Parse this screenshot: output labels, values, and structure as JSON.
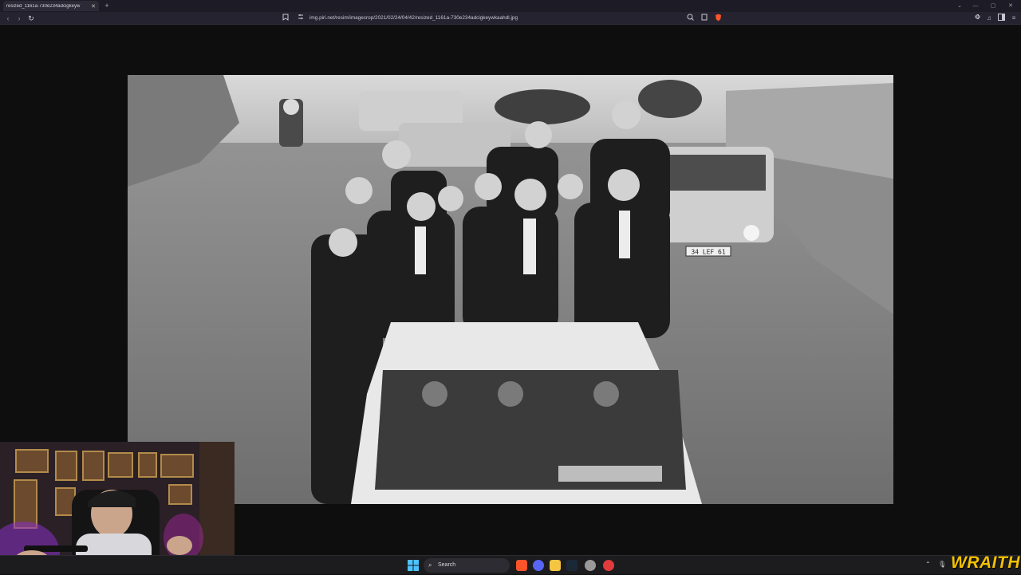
{
  "browser": {
    "tab_title": "resized_1161a-730e234adcigkeyw",
    "tab_close": "✕",
    "new_tab": "+",
    "url": "img.piri.net/resim/imagecrop/2021/02/24/04/42/resized_1161a-730e234adcigkeywkaahdl.jpg",
    "window_controls": [
      "⌄",
      "—",
      "▢",
      "✕"
    ]
  },
  "photo": {
    "plate_text": "34 LEF 61"
  },
  "taskbar": {
    "search_label": "Search"
  },
  "overlay": {
    "brand": "WRAITH"
  }
}
